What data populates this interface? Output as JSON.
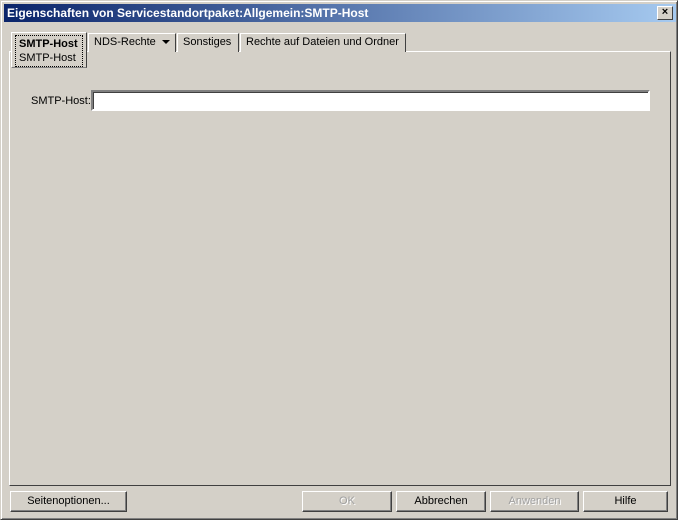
{
  "window": {
    "title": "Eigenschaften von Servicestandortpaket:Allgemein:SMTP-Host",
    "close": "×"
  },
  "tabs": [
    {
      "label": "SMTP-Host",
      "sublabel": "SMTP-Host"
    },
    {
      "label": "NDS-Rechte"
    },
    {
      "label": "Sonstiges"
    },
    {
      "label": "Rechte auf Dateien und Ordner"
    }
  ],
  "form": {
    "smtp_host_label": "SMTP-Host:",
    "smtp_host_value": ""
  },
  "buttons": {
    "page_options": "Seitenoptionen...",
    "ok": "OK",
    "cancel": "Abbrechen",
    "apply": "Anwenden",
    "help": "Hilfe"
  }
}
